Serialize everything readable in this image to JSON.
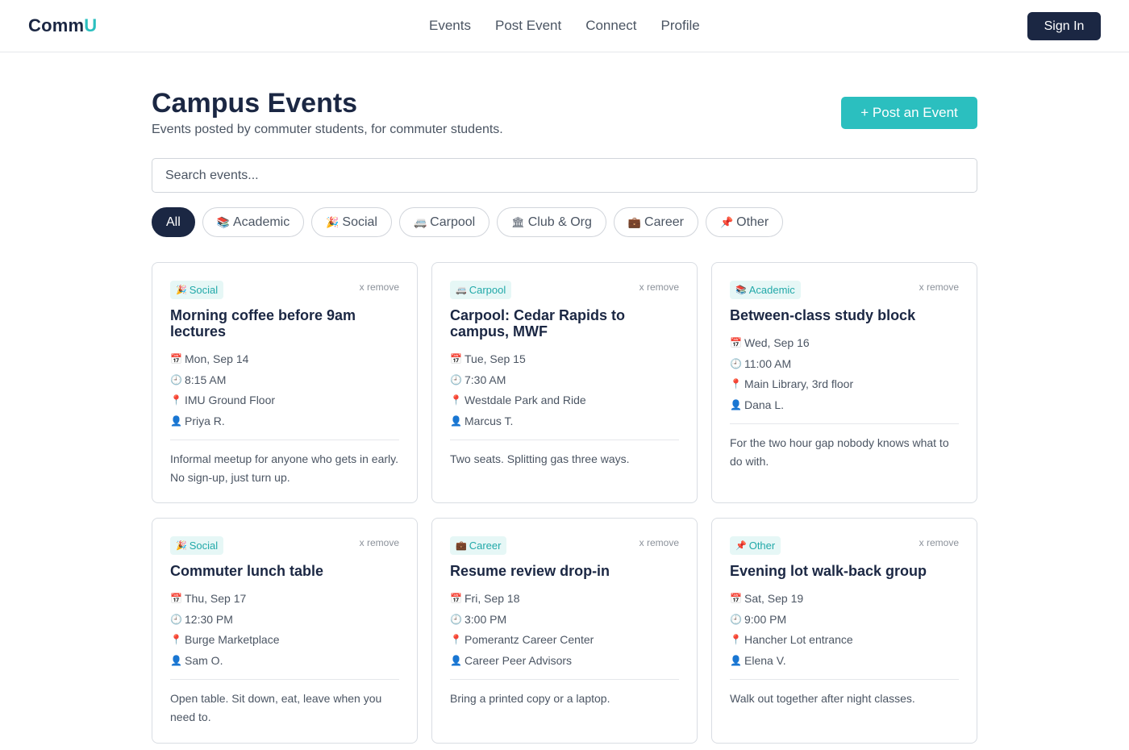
{
  "header": {
    "logo_main": "Comm",
    "logo_accent": "U",
    "nav": [
      "Events",
      "Post Event",
      "Connect",
      "Profile"
    ],
    "signin_label": "Sign In"
  },
  "page": {
    "title": "Campus Events",
    "subtitle": "Events posted by commuter students, for commuter students.",
    "post_button": "+ Post an Event",
    "search_placeholder": "Search events..."
  },
  "filters": [
    {
      "label": "All",
      "emoji": "",
      "active": true
    },
    {
      "label": "Academic",
      "emoji": "📚",
      "active": false
    },
    {
      "label": "Social",
      "emoji": "🎉",
      "active": false
    },
    {
      "label": "Carpool",
      "emoji": "🚐",
      "active": false
    },
    {
      "label": "Club & Org",
      "emoji": "🏛",
      "active": false
    },
    {
      "label": "Career",
      "emoji": "💼",
      "active": false
    },
    {
      "label": "Other",
      "emoji": "📌",
      "active": false
    }
  ],
  "icons": {
    "date": "📅",
    "time": "🕘",
    "place": "📍",
    "person": "👤"
  },
  "remove_label": "x remove",
  "events": [
    {
      "tag": "Social",
      "tag_emoji": "🎉",
      "title": "Morning coffee before 9am lectures",
      "date": "Mon, Sep 14",
      "time": "8:15 AM",
      "location": "IMU Ground Floor",
      "host": "Priya R.",
      "description": "Informal meetup for anyone who gets in early. No sign-up, just turn up."
    },
    {
      "tag": "Carpool",
      "tag_emoji": "🚐",
      "title": "Carpool: Cedar Rapids to campus, MWF",
      "date": "Tue, Sep 15",
      "time": "7:30 AM",
      "location": "Westdale Park and Ride",
      "host": "Marcus T.",
      "description": "Two seats. Splitting gas three ways."
    },
    {
      "tag": "Academic",
      "tag_emoji": "📚",
      "title": "Between-class study block",
      "date": "Wed, Sep 16",
      "time": "11:00 AM",
      "location": "Main Library, 3rd floor",
      "host": "Dana L.",
      "description": "For the two hour gap nobody knows what to do with."
    },
    {
      "tag": "Social",
      "tag_emoji": "🎉",
      "title": "Commuter lunch table",
      "date": "Thu, Sep 17",
      "time": "12:30 PM",
      "location": "Burge Marketplace",
      "host": "Sam O.",
      "description": "Open table. Sit down, eat, leave when you need to."
    },
    {
      "tag": "Career",
      "tag_emoji": "💼",
      "title": "Resume review drop-in",
      "date": "Fri, Sep 18",
      "time": "3:00 PM",
      "location": "Pomerantz Career Center",
      "host": "Career Peer Advisors",
      "description": "Bring a printed copy or a laptop."
    },
    {
      "tag": "Other",
      "tag_emoji": "📌",
      "title": "Evening lot walk-back group",
      "date": "Sat, Sep 19",
      "time": "9:00 PM",
      "location": "Hancher Lot entrance",
      "host": "Elena V.",
      "description": "Walk out together after night classes."
    }
  ]
}
